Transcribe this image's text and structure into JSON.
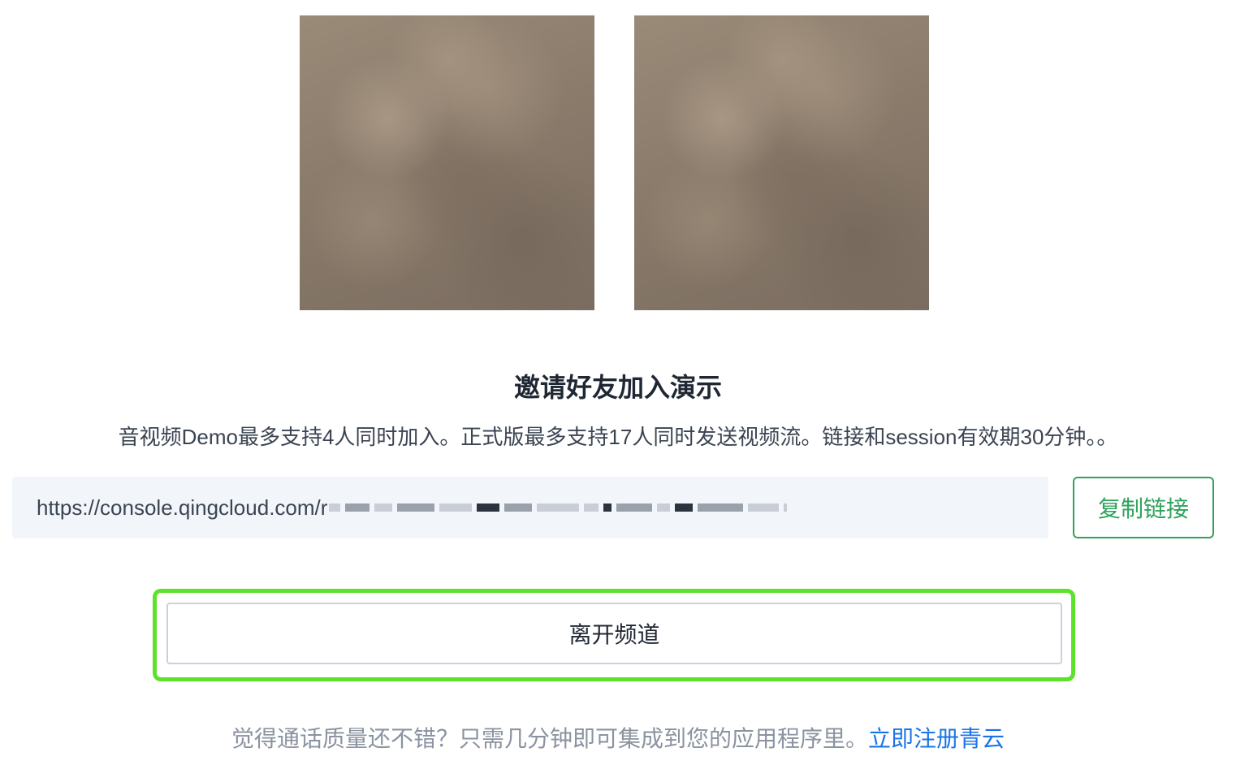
{
  "videos": [
    {
      "id": "video-1",
      "label": ""
    },
    {
      "id": "video-2",
      "label": ""
    }
  ],
  "invite": {
    "title": "邀请好友加入演示",
    "description": "音视频Demo最多支持4人同时加入。正式版最多支持17人同时发送视频流。链接和session有效期30分钟。。",
    "link_visible": "https://console.qingcloud.com/r",
    "copy_label": "复制链接"
  },
  "leave_label": "离开频道",
  "footer": {
    "text": "觉得通话质量还不错？只需几分钟即可集成到您的应用程序里。",
    "link_label": "立即注册青云"
  },
  "colors": {
    "accent_green": "#2fa35e",
    "highlight": "#5ee12a",
    "link_blue": "#1a74e8"
  }
}
